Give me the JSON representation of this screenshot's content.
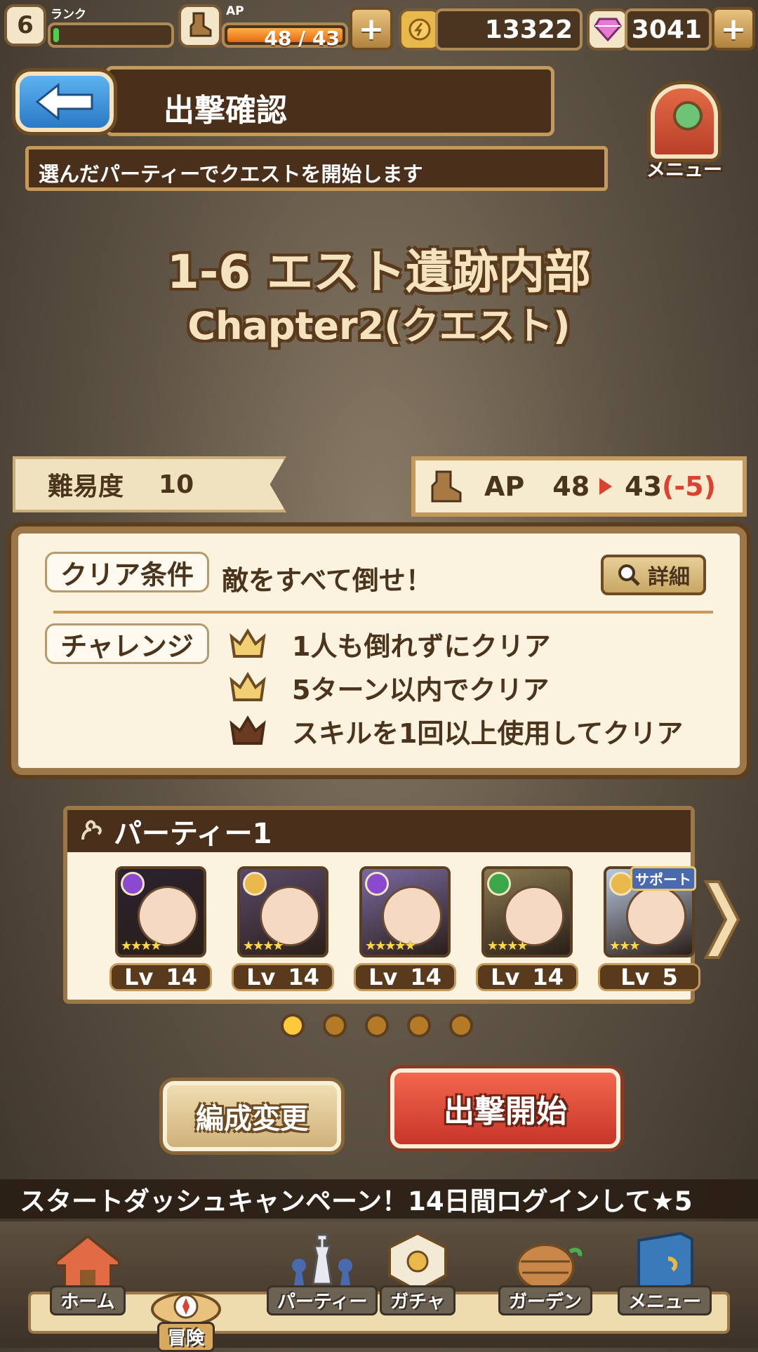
{
  "topbar": {
    "rank_value": "6",
    "rank_label": "ランク",
    "rank_progress": 0.05,
    "ap_label": "AP",
    "ap_text": "48 / 43",
    "ap_progress": 1.0,
    "gold": "13322",
    "gems": "3041",
    "plus_label": "+"
  },
  "header": {
    "title": "出撃確認",
    "subtitle": "選んだパーティーでクエストを開始します",
    "adventure_menu_line1": "冒険",
    "adventure_menu_line2": "メニュー"
  },
  "stage": {
    "title": "1-6  エスト遺跡内部",
    "chapter": "Chapter2(クエスト)"
  },
  "difficulty": {
    "label": "難易度",
    "value": "10"
  },
  "ap_cost": {
    "label": "AP",
    "from": "48",
    "to": "43",
    "diff": "(-5)"
  },
  "conditions": {
    "clear_tag": "クリア条件",
    "clear_text": "敵をすべて倒せ！",
    "detail_button": "詳細",
    "challenge_tag": "チャレンジ",
    "challenges": [
      {
        "text": "1人も倒れずにクリア",
        "achieved": true
      },
      {
        "text": "5ターン以内でクリア",
        "achieved": true
      },
      {
        "text": "スキルを1回以上使用してクリア",
        "achieved": false
      }
    ]
  },
  "party": {
    "name": "パーティー1",
    "members": [
      {
        "lv_label": "Lv",
        "lv": "14",
        "attr": "purple",
        "stars": "★★★★",
        "bg": "#2a2230"
      },
      {
        "lv_label": "Lv",
        "lv": "14",
        "attr": "gold",
        "stars": "★★★★",
        "bg": "#5a4a6a"
      },
      {
        "lv_label": "Lv",
        "lv": "14",
        "attr": "purple",
        "stars": "★★★★★",
        "bg": "#7a6aa0"
      },
      {
        "lv_label": "Lv",
        "lv": "14",
        "attr": "green",
        "stars": "★★★★",
        "bg": "#8a7a50"
      },
      {
        "lv_label": "Lv",
        "lv": "5",
        "attr": "gold",
        "stars": "★★★",
        "bg": "#b8c8e0",
        "support": "サポート"
      }
    ],
    "pages": 5,
    "current_page": 1
  },
  "buttons": {
    "edit": "編成変更",
    "start": "出撃開始"
  },
  "ticker": "スタートダッシュキャンペーン！14日間ログインして★5",
  "nav": [
    {
      "label": "ホーム",
      "icon": "house-icon"
    },
    {
      "label": "冒険",
      "icon": "compass-icon",
      "active": true
    },
    {
      "label": "パーティー",
      "icon": "chess-icon"
    },
    {
      "label": "ガチャ",
      "icon": "dice-icon"
    },
    {
      "label": "ガーデン",
      "icon": "garden-icon"
    },
    {
      "label": "メニュー",
      "icon": "book-icon"
    }
  ],
  "colors": {
    "accent_red": "#d9432f",
    "brown": "#4a2f1a",
    "parchment": "#fbf3e0",
    "gauge_green": "#4cd04a",
    "gauge_orange": "#f08a24"
  }
}
